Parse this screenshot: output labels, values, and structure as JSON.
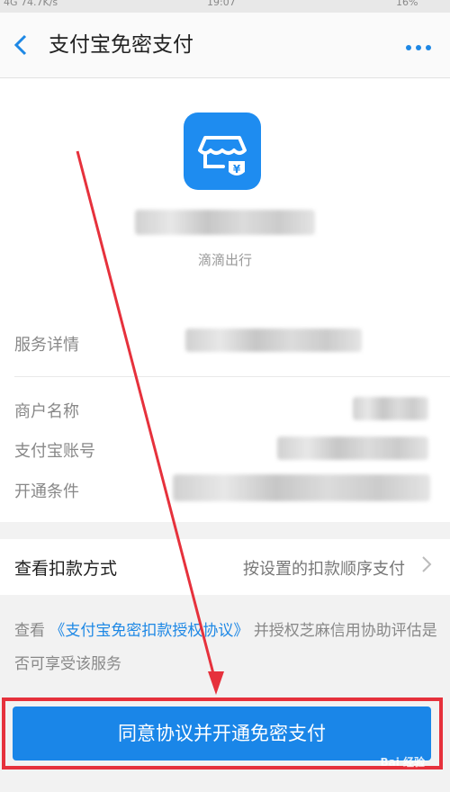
{
  "status_bar": {
    "left": "4G 74.7K/s",
    "time": "19:07",
    "battery": "16%"
  },
  "header": {
    "back_icon": "chevron-left-icon",
    "title": "支付宝免密支付",
    "more_icon": "more-dots-icon"
  },
  "merchant": {
    "icon": "store-yuan-icon",
    "sub_name": "滴滴出行"
  },
  "details": {
    "service_details_label": "服务详情",
    "merchant_name_label": "商户名称",
    "alipay_account_label": "支付宝账号",
    "conditions_label": "开通条件"
  },
  "deduction": {
    "label": "查看扣款方式",
    "value": "按设置的扣款顺序支付",
    "chevron_icon": "chevron-right-icon"
  },
  "agreement": {
    "prefix": "查看",
    "link": "《支付宝免密扣款授权协议》",
    "suffix": "并授权芝麻信用协助评估是否可享受该服务"
  },
  "cta": {
    "label": "同意协议并开通免密支付"
  },
  "watermark": {
    "text": "Bai 经验"
  },
  "colors": {
    "accent": "#1e88e5",
    "annotation": "#e6313c"
  }
}
